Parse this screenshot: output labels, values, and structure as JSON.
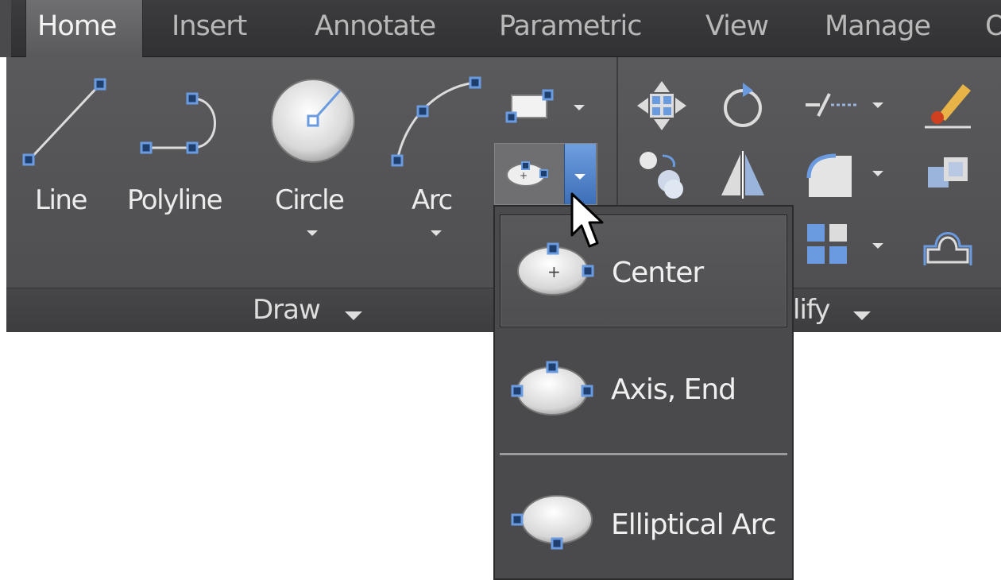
{
  "tabs": [
    {
      "label": "Home",
      "active": true
    },
    {
      "label": "Insert"
    },
    {
      "label": "Annotate"
    },
    {
      "label": "Parametric"
    },
    {
      "label": "View"
    },
    {
      "label": "Manage"
    },
    {
      "label": "O"
    }
  ],
  "draw_panel": {
    "title": "Draw",
    "tools": [
      {
        "label": "Line",
        "icon": "line-icon"
      },
      {
        "label": "Polyline",
        "icon": "polyline-icon"
      },
      {
        "label": "Circle",
        "icon": "circle-icon"
      },
      {
        "label": "Arc",
        "icon": "arc-icon"
      }
    ]
  },
  "modify_panel": {
    "title": "lify"
  },
  "ellipse_menu": {
    "items": [
      {
        "label": "Center",
        "icon": "ellipse-center-icon"
      },
      {
        "label": "Axis, End",
        "icon": "ellipse-axis-end-icon"
      },
      {
        "label": "Elliptical Arc",
        "icon": "elliptical-arc-icon"
      }
    ]
  },
  "colors": {
    "ribbon": "#535355",
    "tabbar": "#363638",
    "grip_blue": "#5b8fd6",
    "accent": "#4f82cc"
  }
}
